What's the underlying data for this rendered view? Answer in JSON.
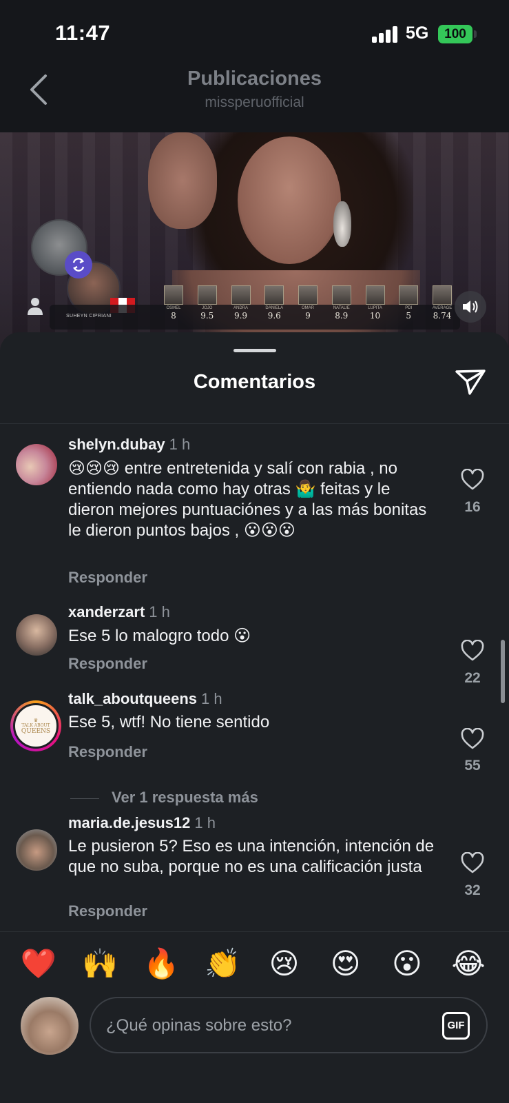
{
  "status_bar": {
    "time": "11:47",
    "network": "5G",
    "battery": "100"
  },
  "header": {
    "title": "Publicaciones",
    "subtitle": "missperuofficial"
  },
  "media": {
    "contestant": "SUHEYN CIPRIANI",
    "judges": [
      {
        "name": "OSMEL",
        "score": "8"
      },
      {
        "name": "JOJO",
        "score": "9.5"
      },
      {
        "name": "ANDRA",
        "score": "9.9"
      },
      {
        "name": "DANIELA",
        "score": "9.6"
      },
      {
        "name": "OMAR",
        "score": "9"
      },
      {
        "name": "NATALIE",
        "score": "8.9"
      },
      {
        "name": "LUPITA",
        "score": "10"
      },
      {
        "name": "PDI",
        "score": "5"
      },
      {
        "name": "AVERAGE",
        "score": "8.74"
      }
    ]
  },
  "sheet": {
    "title": "Comentarios"
  },
  "comments": [
    {
      "user": "shelyn.dubay",
      "ago": "1 h",
      "text": "😢😢😢 entre entretenida y salí con rabia , no entiendo nada como hay otras 🤷‍♂️  feitas y le dieron mejores puntuaciónes y a las más bonitas le dieron puntos bajos , 😮😮😮",
      "reply": "Responder",
      "likes": "16"
    },
    {
      "user": "xanderzart",
      "ago": "1 h",
      "text": "Ese 5 lo malogro todo 😮",
      "reply": "Responder",
      "likes": "22"
    },
    {
      "user": "talk_aboutqueens",
      "ago": "1 h",
      "text": "Ese 5, wtf! No tiene sentido",
      "reply": "Responder",
      "likes": "55",
      "more_replies": "Ver 1 respuesta más"
    },
    {
      "user": "maria.de.jesus12",
      "ago": "1 h",
      "text": "Le pusieron 5? Eso es una intención, intención de que no suba, porque no es una calificación justa",
      "reply": "Responder",
      "likes": "32"
    }
  ],
  "reactions": [
    "❤️",
    "🙌",
    "🔥",
    "👏",
    "😢",
    "😍",
    "😮",
    "😂"
  ],
  "composer": {
    "placeholder": "¿Qué opinas sobre esto?",
    "gif_label": "GIF"
  },
  "colors": {
    "background": "#1d2024",
    "battery": "#34c759",
    "repost": "#5a4cc7"
  }
}
